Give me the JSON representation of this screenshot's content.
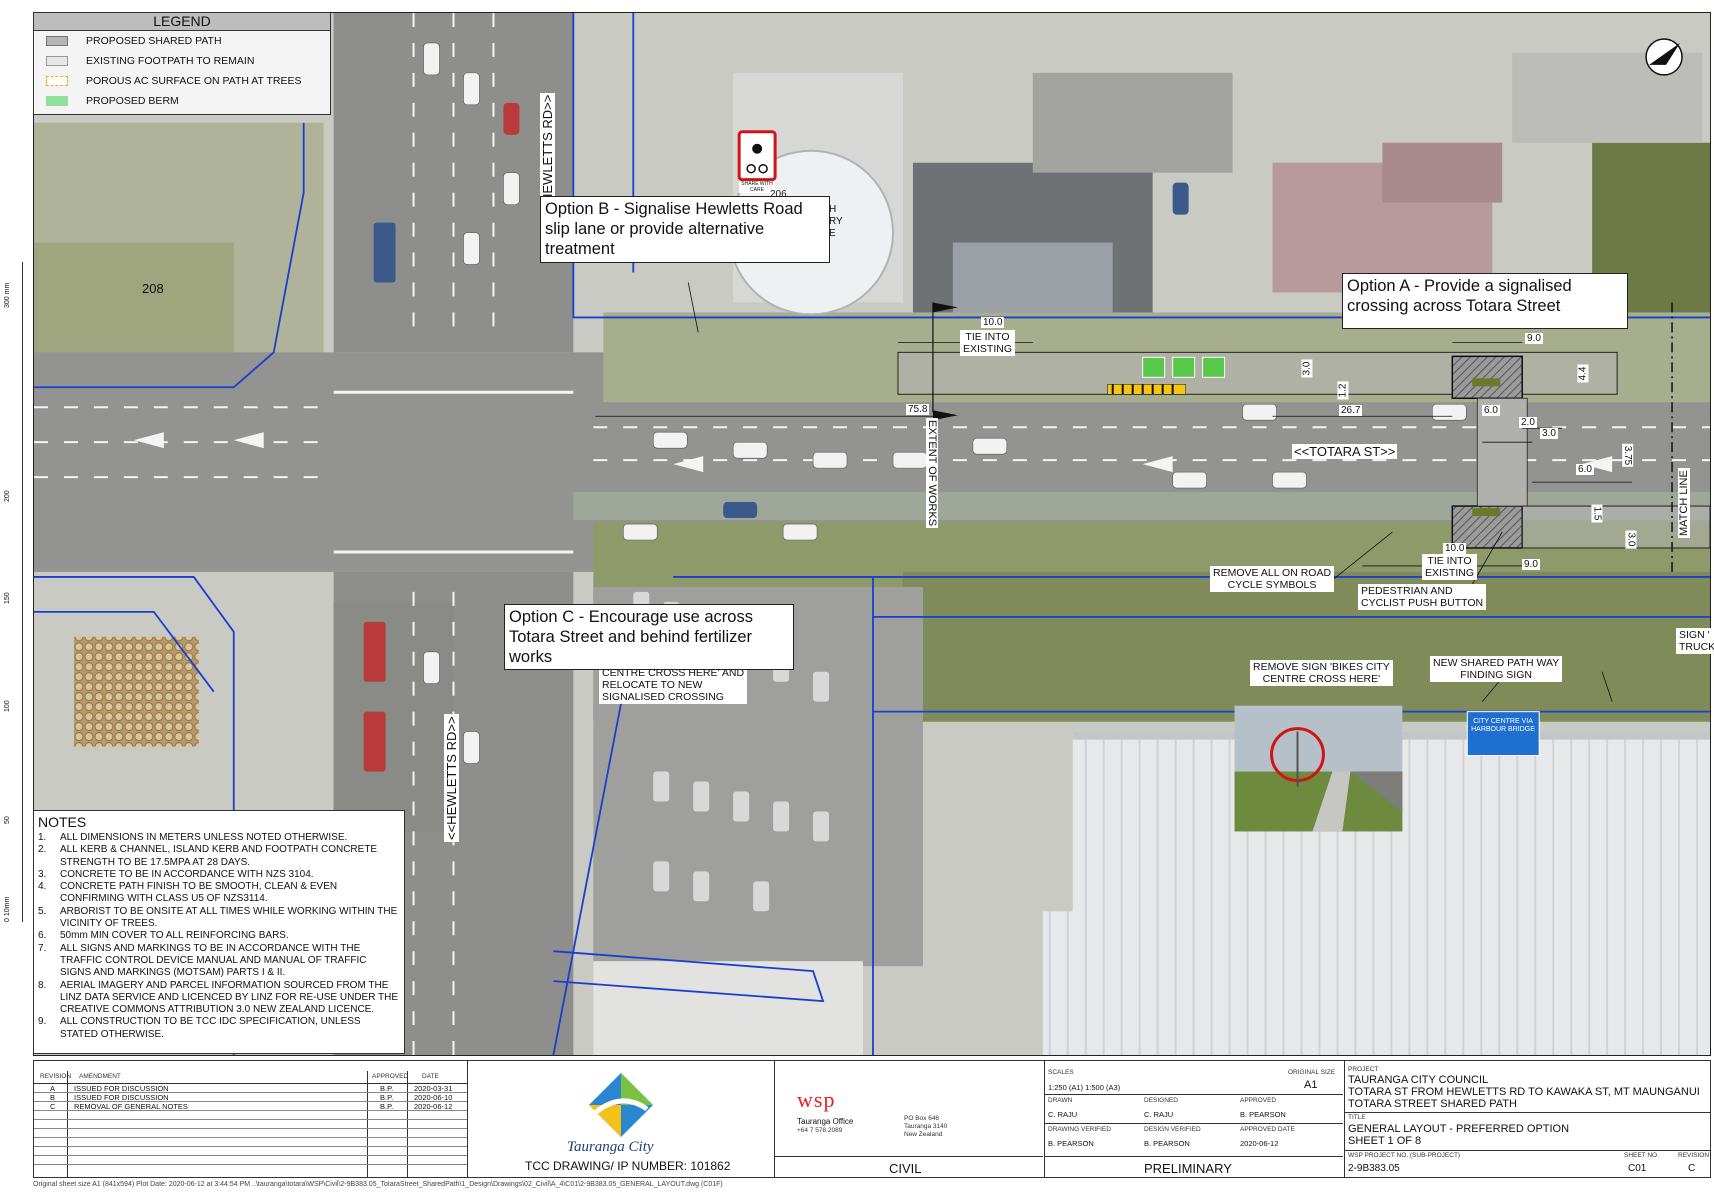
{
  "legend": {
    "title": "LEGEND",
    "items": [
      {
        "label": "PROPOSED SHARED PATH",
        "color": "#b5b5b5"
      },
      {
        "label": "EXISTING FOOTPATH TO REMAIN",
        "color": "#e6e6e6"
      },
      {
        "label": "POROUS AC SURFACE ON PATH AT TREES",
        "color": "#f5a623"
      },
      {
        "label": "PROPOSED BERM",
        "color": "#8ee09a"
      }
    ]
  },
  "callouts": {
    "option_a": "Option A - Provide a signalised crossing across Totara Street",
    "option_b": "Option B - Signalise Hewletts Road slip lane or provide alternative treatment",
    "option_c": "Option  C - Encourage use across Totara Street and behind fertilizer works"
  },
  "map_labels": {
    "hewletts_top": "HEWLETTS RD>>",
    "hewletts_bottom": "<<HEWLETTS RD>>",
    "totara": "<<TOTARA ST>>",
    "property_208": "208",
    "extent_of_works": "EXTENT OF WORKS",
    "match_line": "MATCH LINE",
    "tie_into_existing_1": "TIE INTO\nEXISTING",
    "tie_into_existing_2": "TIE INTO\nEXISTING",
    "remove_cycle_symbols": "REMOVE ALL ON ROAD\nCYCLE SYMBOLS",
    "push_button": "PEDESTRIAN AND\nCYCLIST PUSH BUTTON",
    "remove_sign": "REMOVE SIGN 'BIKES CITY\nCENTRE CROSS HERE'",
    "new_sign": "NEW SHARED PATH WAY\nFINDING SIGN",
    "relocate_sign": "CENTRE CROSS HERE' AND\nRELOCATE TO NEW\nSIGNALISED CROSSING",
    "sign_edge": "SIGN '\nTRUCK",
    "sign_panel_text": "CITY CENTRE VIA\nHARBOUR BRIDGE",
    "share_sign_text": "SHARE WITH CARE",
    "building_text": "H\nRY\nE",
    "building_num": "206"
  },
  "dimensions": [
    "10.0",
    "75.8",
    "9.0",
    "3.0",
    "1.2",
    "4.4",
    "26.7",
    "6.0",
    "2.0",
    "3.0",
    "3.75",
    "6.0",
    "1.5",
    "3.0",
    "10.0",
    "9.0"
  ],
  "scale_ticks": [
    "300 mm",
    "200",
    "150",
    "100",
    "50",
    "0  10mm"
  ],
  "notes": {
    "title": "NOTES",
    "items": [
      {
        "n": "1.",
        "text": "ALL DIMENSIONS IN METERS UNLESS NOTED OTHERWISE."
      },
      {
        "n": "2.",
        "text": "ALL KERB & CHANNEL, ISLAND KERB AND FOOTPATH CONCRETE STRENGTH TO BE 17.5MPA AT 28 DAYS."
      },
      {
        "n": "3.",
        "text": "CONCRETE TO BE IN ACCORDANCE WITH NZS 3104."
      },
      {
        "n": "4.",
        "text": "CONCRETE PATH FINISH TO BE SMOOTH, CLEAN & EVEN CONFIRMING WITH CLASS U5 OF NZS3114."
      },
      {
        "n": "5.",
        "text": "ARBORIST TO BE ONSITE AT ALL TIMES WHILE WORKING WITHIN THE VICINITY OF TREES."
      },
      {
        "n": "6.",
        "text": "50mm MIN COVER TO ALL REINFORCING BARS."
      },
      {
        "n": "7.",
        "text": "ALL SIGNS AND MARKINGS TO BE IN ACCORDANCE WITH THE TRAFFIC CONTROL DEVICE MANUAL AND  MANUAL OF TRAFFIC SIGNS AND MARKINGS (MOTSAM) PARTS I & II."
      },
      {
        "n": "8.",
        "text": "AERIAL IMAGERY AND PARCEL INFORMATION SOURCED FROM THE LINZ DATA SERVICE AND LICENCED BY LINZ FOR RE-USE UNDER THE CREATIVE COMMONS ATTRIBUTION 3.0 NEW ZEALAND LICENCE."
      },
      {
        "n": "9.",
        "text": "ALL CONSTRUCTION TO BE TCC IDC SPECIFICATION, UNLESS STATED OTHERWISE."
      }
    ]
  },
  "title_block": {
    "revisions": {
      "headers": [
        "REVISION",
        "AMENDMENT",
        "APPROVED",
        "DATE"
      ],
      "rows": [
        [
          "A",
          "ISSUED FOR DISCUSSION",
          "B.P.",
          "2020-03-31"
        ],
        [
          "B",
          "ISSUED FOR DISCUSSION",
          "B.P.",
          "2020-06-10"
        ],
        [
          "C",
          "REMOVAL OF GENERAL NOTES",
          "B.P.",
          "2020-06-12"
        ]
      ]
    },
    "tauranga_logo_text": "Tauranga City",
    "tcc_drawing": "TCC DRAWING/ IP NUMBER: 101862",
    "wsp": {
      "logo": "wsp",
      "office": "Tauranga Office",
      "phone": "+64 7 578 2089",
      "address": "PO Box 646\nTauranga 3140\nNew Zealand"
    },
    "discipline": "CIVIL",
    "scales_label": "SCALES",
    "scales": "1:250 (A1) 1:500 (A3)",
    "original_size_label": "ORIGINAL SIZE",
    "original_size": "A1",
    "drawn_label": "DRAWN",
    "drawn": "C. RAJU",
    "designed_label": "DESIGNED",
    "designed": "C. RAJU",
    "approved_label": "APPROVED",
    "approved": "B. PEARSON",
    "drawing_verified_label": "DRAWING VERIFIED",
    "drawing_verified": "B. PEARSON",
    "design_verified_label": "DESIGN VERIFIED",
    "design_verified": "B. PEARSON",
    "approved_date_label": "APPROVED DATE",
    "approved_date": "2020-06-12",
    "status": "PRELIMINARY",
    "project_label": "PROJECT",
    "project_lines": [
      "TAURANGA CITY COUNCIL",
      "TOTARA ST FROM HEWLETTS RD TO KAWAKA ST, MT MAUNGANUI",
      "TOTARA STREET SHARED PATH"
    ],
    "title_label": "TITLE",
    "title_lines": [
      "GENERAL LAYOUT - PREFERRED OPTION",
      "SHEET 1 OF 8"
    ],
    "wsp_project_label": "WSP PROJECT NO. (SUB-PROJECT)",
    "wsp_project_no": "2-9B383.05",
    "sheet_no_label": "SHEET NO.",
    "sheet_no": "C01",
    "revision_label": "REVISION",
    "revision": "C"
  },
  "footer": "Original sheet size A1 (841x594)    Plot Date: 2020-06-12 at 3:44:54 PM        ..\\tauranga\\totara\\WSP\\Civil\\2-9B383.05_TotaraStreet_SharedPath\\1_Design\\Drawings\\02_Civil\\A_4\\C01\\2-9B383.05_GENERAL_LAYOUT.dwg (C01F)"
}
